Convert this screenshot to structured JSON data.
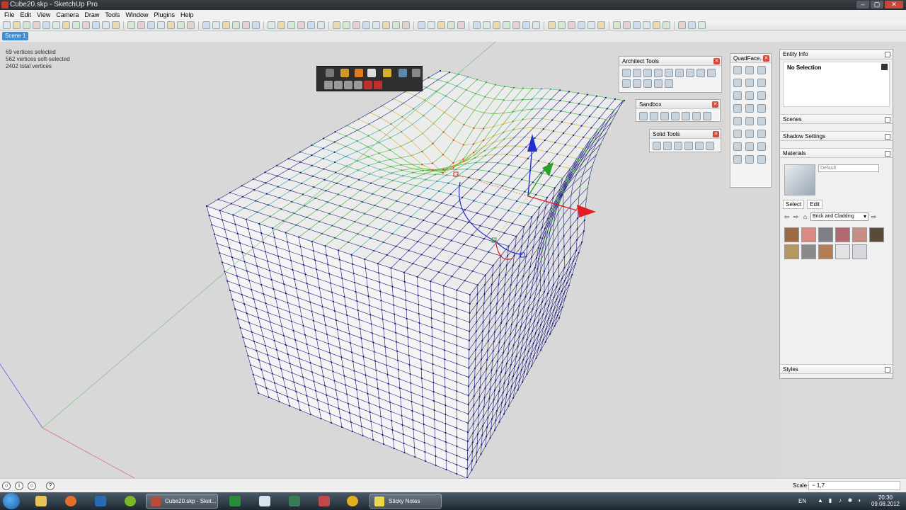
{
  "window": {
    "title": "Cube20.skp - SketchUp Pro",
    "controls": {
      "minimize": "–",
      "maximize": "▢",
      "close": "✕"
    }
  },
  "menu": [
    "File",
    "Edit",
    "View",
    "Camera",
    "Draw",
    "Tools",
    "Window",
    "Plugins",
    "Help"
  ],
  "scene_tab": "Scene 1",
  "viewport": {
    "status_lines": [
      "69 vertices selected",
      "562 vertices soft-selected",
      "2402 total vertices"
    ]
  },
  "toolwindows": {
    "architect": {
      "title": "Architect Tools"
    },
    "sandbox": {
      "title": "Sandbox"
    },
    "solid": {
      "title": "Solid Tools"
    },
    "quadface": {
      "title": "QuadFace..."
    }
  },
  "tray": {
    "entity_info": {
      "title": "Entity Info",
      "selection": "No Selection"
    },
    "scenes": {
      "title": "Scenes"
    },
    "shadow": {
      "title": "Shadow Settings"
    },
    "materials": {
      "title": "Materials",
      "name_value": "Default",
      "tab_select": "Select",
      "tab_edit": "Edit",
      "library": "Brick and Cladding",
      "swatch_colors": [
        "#9c6a42",
        "#d98a85",
        "#7c7f86",
        "#b06a6f",
        "#c58f86",
        "#5a4a3a",
        "#b49762",
        "#8a8a8a",
        "#b27e56",
        "#e3e3e6",
        "#d6d6dc"
      ]
    },
    "styles": {
      "title": "Styles"
    }
  },
  "statusbar": {
    "scale_label": "Scale",
    "scale_value": "~ 1,7"
  },
  "taskbar": {
    "tasks": [
      {
        "label": "Cube20.skp - Sket...",
        "color": "#b84a3a"
      },
      {
        "label": "Sticky Notes",
        "color": "#e8d84a"
      }
    ],
    "language": "EN",
    "time": "20:30",
    "date": "09.08.2012"
  },
  "colors": {
    "axis_red": "#e02020",
    "axis_green": "#2aa02a",
    "axis_blue": "#2030d0",
    "mesh_dark": "#1a1a7a"
  }
}
